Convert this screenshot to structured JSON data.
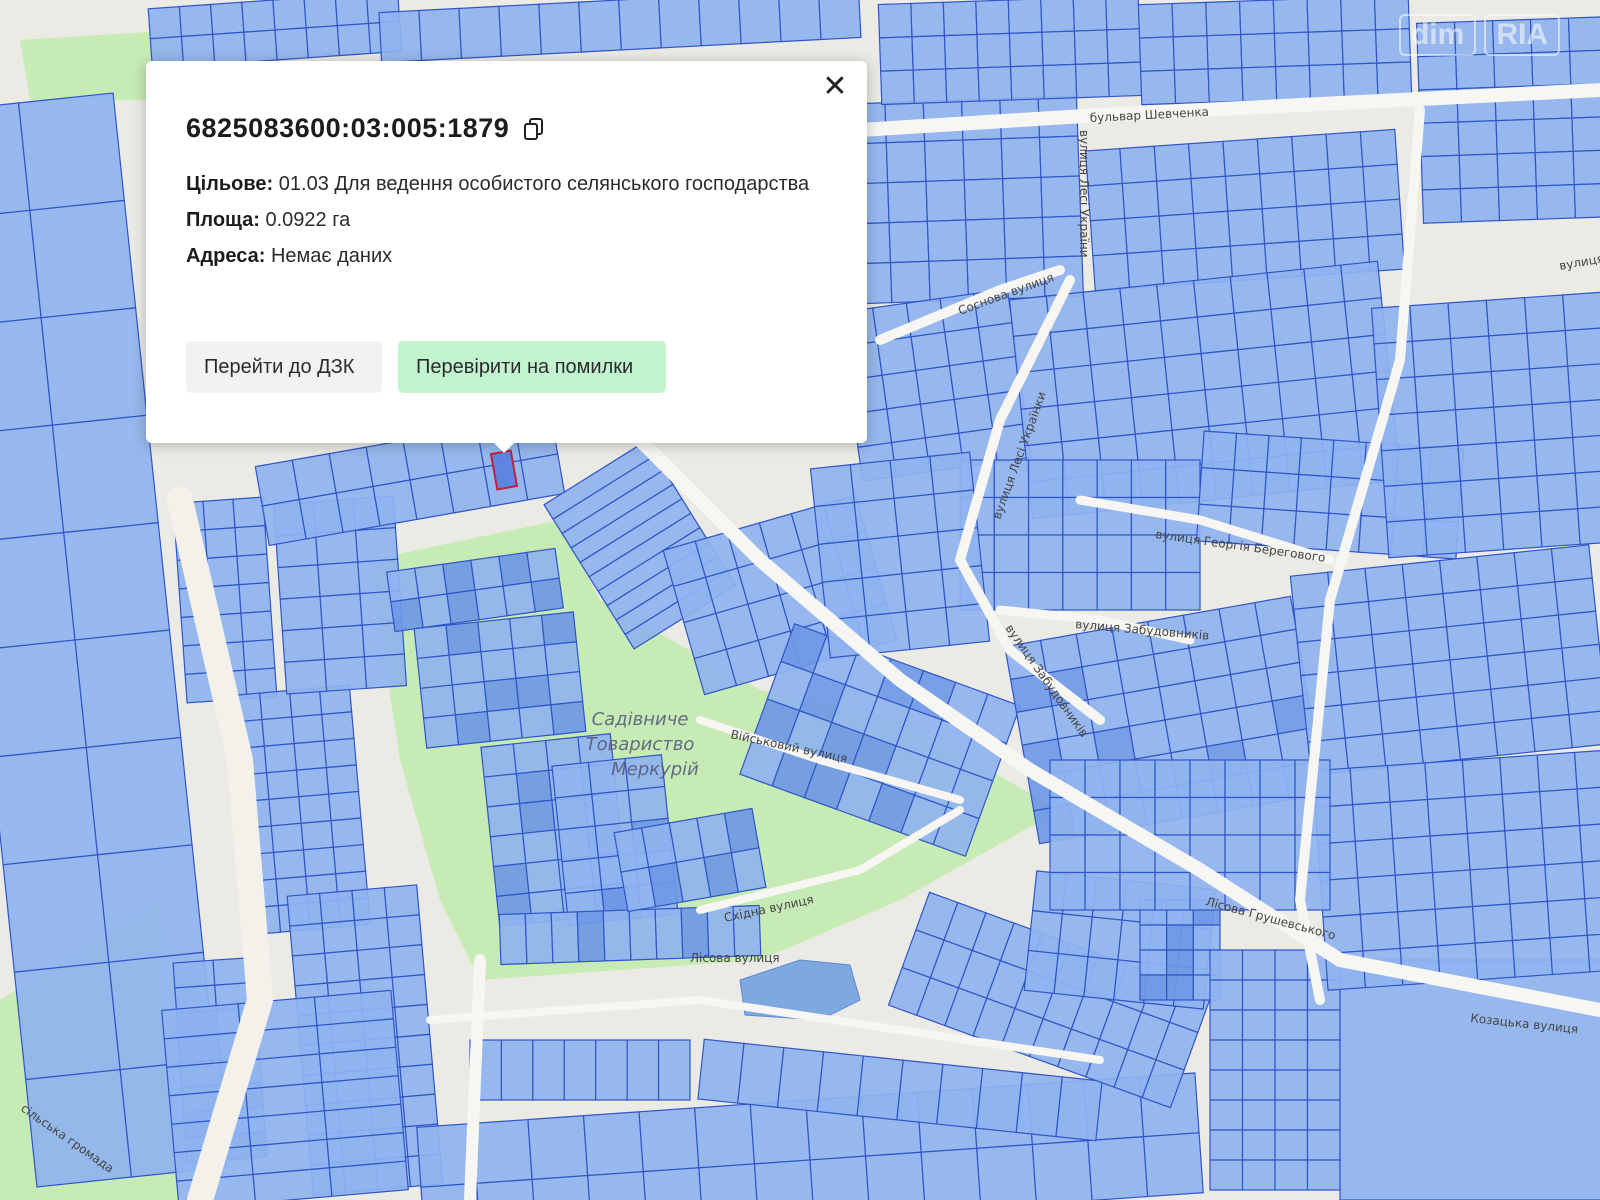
{
  "map": {
    "colors": {
      "background": "#eceae5",
      "parcel_fill": "#8fb3ef",
      "parcel_fill_dark": "#6f98e6",
      "parcel_stroke": "#2f55c8",
      "green_area": "#c6ebb4",
      "selected_stroke": "#c0223a"
    },
    "area_label": [
      "Садівниче",
      "Товариство",
      "Меркурій"
    ],
    "street_labels": {
      "shevchenka": "бульвар Шевченка",
      "lesi_ukrainky": "вулиця Лесі України",
      "sosnova": "Соснова вулиця",
      "lesi_ukrainky_2": "вулиця Лесі Українки",
      "berehovoho": "вулиця Георгія Берегового",
      "zabudovnykiv": "вулиця Забудовників",
      "zabudovnykiv_2": "вулиця Забудовників",
      "viiskovyi": "Військовий вулиця",
      "skhidna": "Східна вулиця",
      "lisova": "Лісова вулиця",
      "grushevskoho": "Лісова Грушевського",
      "kozatska": "Козацька вулиця",
      "selyshche": "сільська громада",
      "right_top": "вулиця"
    },
    "watermark": [
      "dim",
      "RIA"
    ]
  },
  "popup": {
    "parcel_id": "6825083600:03:005:1879",
    "fields": [
      {
        "label": "Цільове:",
        "value": "01.03 Для ведення особистого селянського господарства"
      },
      {
        "label": "Площа:",
        "value": "0.0922 га"
      },
      {
        "label": "Адреса:",
        "value": "Немає даних"
      }
    ],
    "buttons": {
      "dzk": "Перейти до ДЗК",
      "check": "Перевірити на помилки"
    },
    "close_icon": "close-icon",
    "copy_icon": "copy-icon"
  }
}
